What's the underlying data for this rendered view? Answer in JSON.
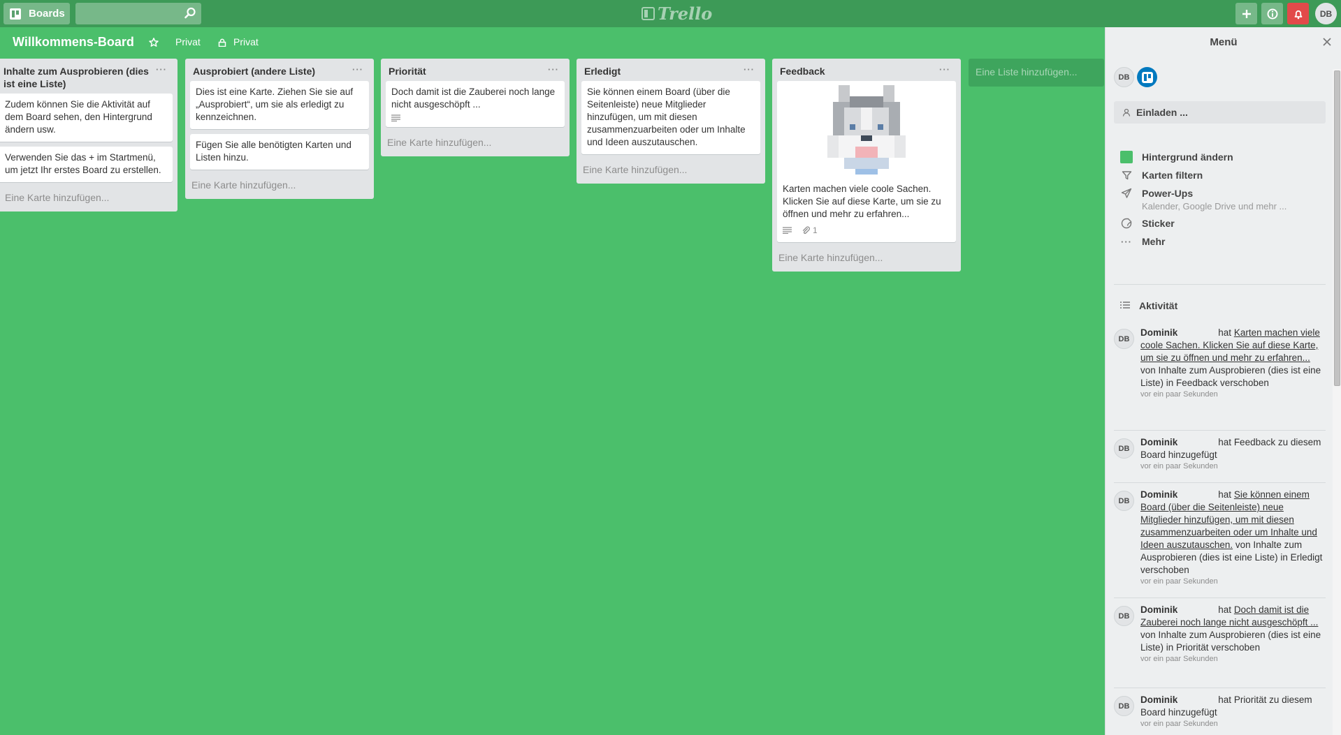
{
  "header": {
    "boards_label": "Boards",
    "search_value": "",
    "logo_text": "Trello",
    "add_icon": "plus-icon",
    "info_icon": "info-icon",
    "notification_icon": "bell-icon",
    "avatar_initials": "DB"
  },
  "board": {
    "title": "Willkommens-Board",
    "visibility_label": "Privat",
    "team_label": "Privat"
  },
  "lists": [
    {
      "title": "Inhalte zum Ausprobieren (dies ist eine Liste)",
      "cards": [
        {
          "text": "Zudem können Sie die Aktivität auf dem Board sehen, den Hintergrund ändern usw."
        },
        {
          "text": "Verwenden Sie das + im Startmenü, um jetzt Ihr erstes Board zu erstellen."
        }
      ],
      "add_card": "Eine Karte hinzufügen..."
    },
    {
      "title": "Ausprobiert (andere Liste)",
      "cards": [
        {
          "text": "Dies ist eine Karte. Ziehen Sie sie auf „Ausprobiert“, um sie als erledigt zu kennzeichnen."
        },
        {
          "text": "Fügen Sie alle benötigten Karten und Listen hinzu."
        }
      ],
      "add_card": "Eine Karte hinzufügen..."
    },
    {
      "title": "Priorität",
      "cards": [
        {
          "text": "Doch damit ist die Zauberei noch lange nicht ausgeschöpft ..."
        }
      ],
      "add_card": "Eine Karte hinzufügen..."
    },
    {
      "title": "Erledigt",
      "cards": [
        {
          "text": "Sie können einem Board (über die Seitenleiste) neue Mitglieder hinzufügen, um mit diesen zusammenzuarbeiten oder um Inhalte und Ideen auszutauschen."
        }
      ],
      "add_card": "Eine Karte hinzufügen..."
    },
    {
      "title": "Feedback",
      "cards": [
        {
          "text": "Karten machen viele coole Sachen. Klicken Sie auf diese Karte, um sie zu öffnen und mehr zu erfahren...",
          "attachments": "1"
        }
      ],
      "add_card": "Eine Karte hinzufügen..."
    }
  ],
  "add_list_label": "Eine Liste hinzufügen...",
  "sidebar": {
    "title": "Menü",
    "member_initials": "DB",
    "invite_label": "Einladen ...",
    "menu": [
      {
        "label": "Hintergrund ändern",
        "icon": "color-swatch-icon",
        "color": "#4bbf6b"
      },
      {
        "label": "Karten filtern",
        "icon": "filter-icon"
      },
      {
        "label": "Power-Ups",
        "sub": "Kalender, Google Drive und mehr ...",
        "icon": "rocket-icon"
      },
      {
        "label": "Sticker",
        "icon": "sticker-icon"
      },
      {
        "label": "Mehr",
        "icon": "more-icon"
      }
    ],
    "activity_title": "Aktivität",
    "activities": [
      {
        "initials": "DB",
        "name": "Dominik",
        "verb": "hat",
        "link": "Karten machen viele coole Sachen. Klicken Sie auf diese Karte, um sie zu öffnen und mehr zu erfahren...",
        "rest": " von Inhalte zum Ausprobieren (dies ist eine Liste) in Feedback verschoben",
        "time": "vor ein paar Sekunden"
      },
      {
        "initials": "DB",
        "name": "Dominik",
        "verb": "hat",
        "link": "",
        "rest": "Feedback zu diesem Board hinzugefügt",
        "time": "vor ein paar Sekunden"
      },
      {
        "initials": "DB",
        "name": "Dominik",
        "verb": "hat",
        "link": "Sie können einem Board (über die Seitenleiste) neue Mitglieder hinzufügen, um mit diesen zusammenzuarbeiten oder um Inhalte und Ideen auszutauschen.",
        "rest": " von Inhalte zum Ausprobieren (dies ist eine Liste) in Erledigt verschoben",
        "time": "vor ein paar Sekunden"
      },
      {
        "initials": "DB",
        "name": "Dominik",
        "verb": "hat",
        "link": "Doch damit ist die Zauberei noch lange nicht ausgeschöpft ...",
        "rest": " von Inhalte zum Ausprobieren (dies ist eine Liste) in Priorität verschoben",
        "time": "vor ein paar Sekunden"
      },
      {
        "initials": "DB",
        "name": "Dominik",
        "verb": "hat",
        "link": "",
        "rest": "Priorität zu diesem Board hinzugefügt",
        "time": "vor ein paar Sekunden"
      }
    ]
  }
}
